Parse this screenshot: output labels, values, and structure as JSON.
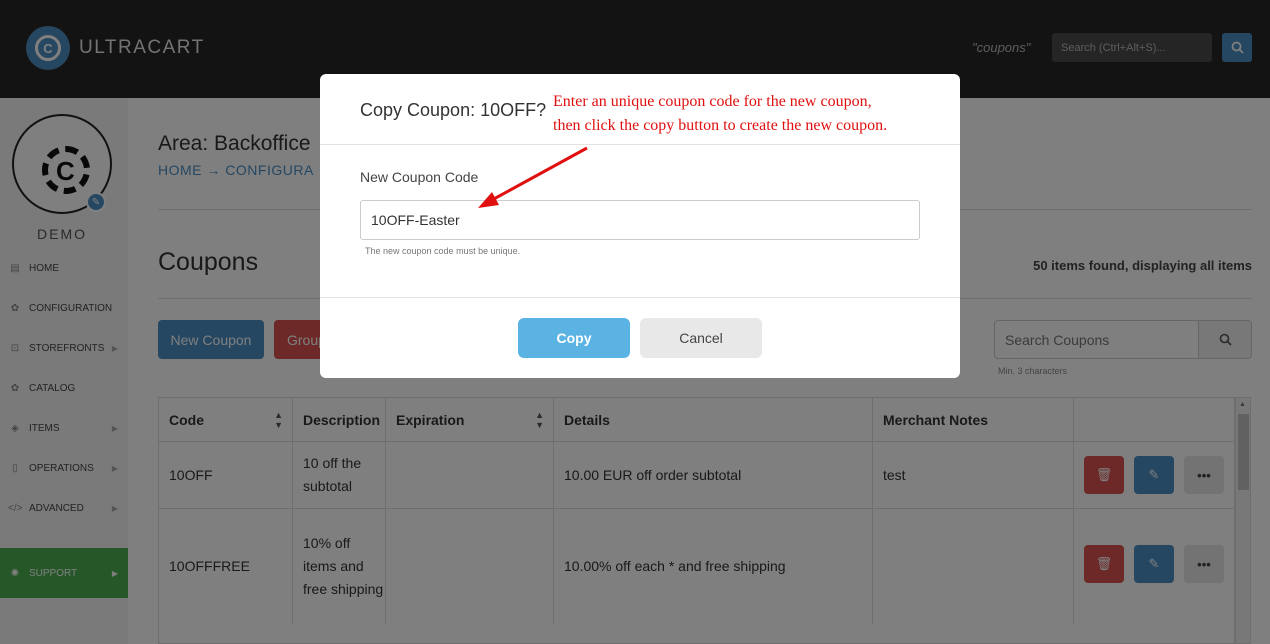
{
  "topbar": {
    "logo_text": "ULTRACART",
    "search_hint": "\"coupons\"",
    "search_placeholder": "Search (Ctrl+Alt+S)..."
  },
  "sidebar": {
    "user_label": "DEMO",
    "items": [
      {
        "label": "HOME",
        "icon": "home-icon"
      },
      {
        "label": "CONFIGURATION",
        "icon": "gear-icon"
      },
      {
        "label": "STOREFRONTS",
        "icon": "cart-icon"
      },
      {
        "label": "CATALOG",
        "icon": "gear-icon"
      },
      {
        "label": "ITEMS",
        "icon": "tags-icon"
      },
      {
        "label": "OPERATIONS",
        "icon": "clipboard-icon"
      },
      {
        "label": "ADVANCED",
        "icon": "code-icon"
      },
      {
        "label": "SUPPORT",
        "icon": "lightbulb-icon"
      }
    ],
    "support_color": "#4caf50"
  },
  "main": {
    "area_title": "Area: Backoffice",
    "breadcrumb": "HOME → CONFIGURA",
    "page_title": "Coupons",
    "items_found": "50 items found, displaying all items",
    "new_coupon_label": "New Coupon",
    "group_label": "Group",
    "search_placeholder": "Search Coupons",
    "min_chars": "Min. 3 characters"
  },
  "table": {
    "columns": [
      "Code",
      "Description",
      "Expiration",
      "Details",
      "Merchant Notes"
    ],
    "rows": [
      {
        "code": "10OFF",
        "description": "10 off the subtotal",
        "expiration": "",
        "details": "10.00 EUR off order subtotal",
        "notes": "test"
      },
      {
        "code": "10OFFFREE",
        "description": "10% off items and free shipping",
        "expiration": "",
        "details": "10.00% off each * and free shipping",
        "notes": ""
      }
    ]
  },
  "modal": {
    "title": "Copy Coupon: 10OFF?",
    "field_label": "New Coupon Code",
    "field_value": "10OFF-Easter",
    "field_help": "The new coupon code must be unique.",
    "copy_label": "Copy",
    "cancel_label": "Cancel"
  },
  "annotation": {
    "line1": "Enter an unique coupon code for the new coupon,",
    "line2": "then click the copy button to create the new coupon.",
    "color": "#e01010"
  },
  "colors": {
    "accent": "#4a8fc4",
    "danger": "#d9534f",
    "copy_button": "#5bb3e4"
  }
}
